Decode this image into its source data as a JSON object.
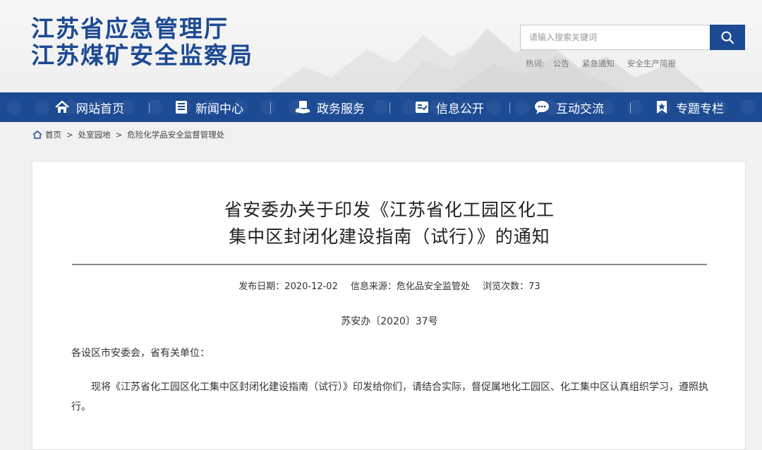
{
  "header": {
    "logo_line1": "江苏省应急管理厅",
    "logo_line2": "江苏煤矿安全监察局",
    "brand_color": "#1c4a93"
  },
  "search": {
    "placeholder": "请输入搜索关键词",
    "button_icon": "search-icon"
  },
  "hotwords": {
    "label": "热词:",
    "items": [
      "公告",
      "紧急通知",
      "安全生产简报"
    ]
  },
  "nav": {
    "items": [
      {
        "label": "网站首页",
        "icon": "home-icon"
      },
      {
        "label": "新闻中心",
        "icon": "news-icon"
      },
      {
        "label": "政务服务",
        "icon": "service-icon"
      },
      {
        "label": "信息公开",
        "icon": "info-icon"
      },
      {
        "label": "互动交流",
        "icon": "chat-icon"
      },
      {
        "label": "专题专栏",
        "icon": "bookmark-icon"
      }
    ]
  },
  "breadcrumb": {
    "home": "首页",
    "items": [
      "处室园地",
      "危险化学品安全监督管理处"
    ]
  },
  "article": {
    "title_line1": "省安委办关于印发《江苏省化工园区化工",
    "title_line2": "集中区封闭化建设指南（试行）》的通知",
    "publish_date": "发布日期：2020-12-02",
    "source": "信息来源：危化品安全监管处",
    "views": "浏览次数：73",
    "doc_number": "苏安办〔2020〕37号",
    "salutation": "各设区市安委会，省有关单位：",
    "paragraph": "现将《江苏省化工园区化工集中区封闭化建设指南（试行）》印发给你们，请结合实际，督促属地化工园区、化工集中区认真组织学习，遵照执行。"
  }
}
